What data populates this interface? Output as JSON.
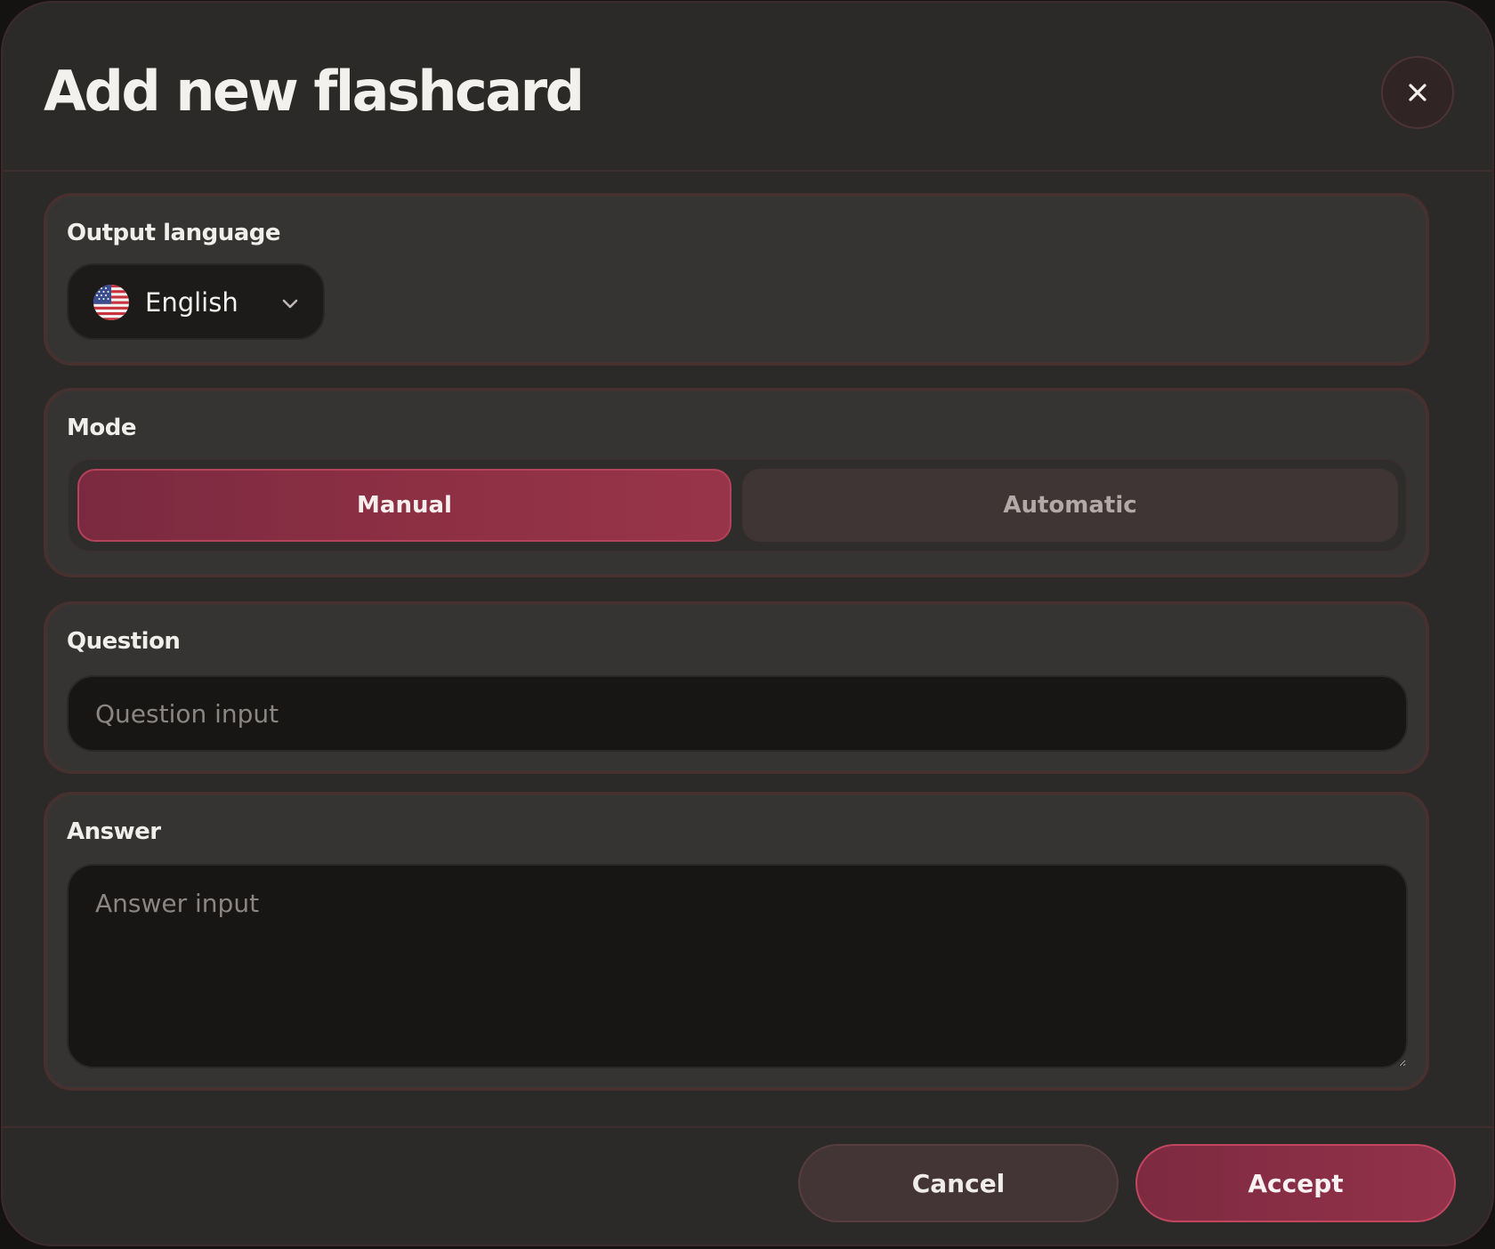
{
  "modal": {
    "title": "Add new flashcard",
    "close_icon": "close-icon"
  },
  "output_language": {
    "label": "Output language",
    "selected": "English",
    "flag_icon": "us-flag-icon",
    "dropdown_icon": "chevron-down-icon"
  },
  "mode": {
    "label": "Mode",
    "options": [
      "Manual",
      "Automatic"
    ],
    "selected": "Manual"
  },
  "question": {
    "label": "Question",
    "placeholder": "Question input",
    "value": ""
  },
  "answer": {
    "label": "Answer",
    "placeholder": "Answer input",
    "value": ""
  },
  "footer": {
    "cancel_label": "Cancel",
    "accept_label": "Accept"
  },
  "colors": {
    "accent": "#8e3044",
    "background": "#2c2a29",
    "section_border": "#48302f"
  }
}
